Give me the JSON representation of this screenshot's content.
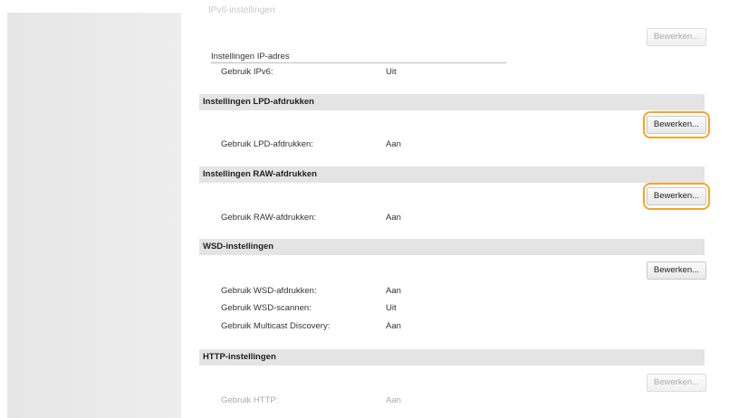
{
  "top_faded_label": "IPv6-instellingen",
  "edit_label": "Bewerken...",
  "ipv6": {
    "subheading": "Instellingen IP-adres",
    "rows": [
      {
        "label": "Gebruik IPv6:",
        "value": "Uit"
      }
    ]
  },
  "lpd": {
    "title": "Instellingen LPD-afdrukken",
    "rows": [
      {
        "label": "Gebruik LPD-afdrukken:",
        "value": "Aan"
      }
    ]
  },
  "raw": {
    "title": "Instellingen RAW-afdrukken",
    "rows": [
      {
        "label": "Gebruik RAW-afdrukken:",
        "value": "Aan"
      }
    ]
  },
  "wsd": {
    "title": "WSD-instellingen",
    "rows": [
      {
        "label": "Gebruik WSD-afdrukken:",
        "value": "Aan"
      },
      {
        "label": "Gebruik WSD-scannen:",
        "value": "Uit"
      },
      {
        "label": "Gebruik Multicast Discovery:",
        "value": "Aan"
      }
    ]
  },
  "http": {
    "title": "HTTP-instellingen",
    "rows": [
      {
        "label": "Gebruik HTTP:",
        "value": "Aan"
      }
    ]
  },
  "colors": {
    "highlight": "#f5a623",
    "section_bg": "#e4e4e4",
    "sidebar_bg": "#e8e8e8"
  }
}
